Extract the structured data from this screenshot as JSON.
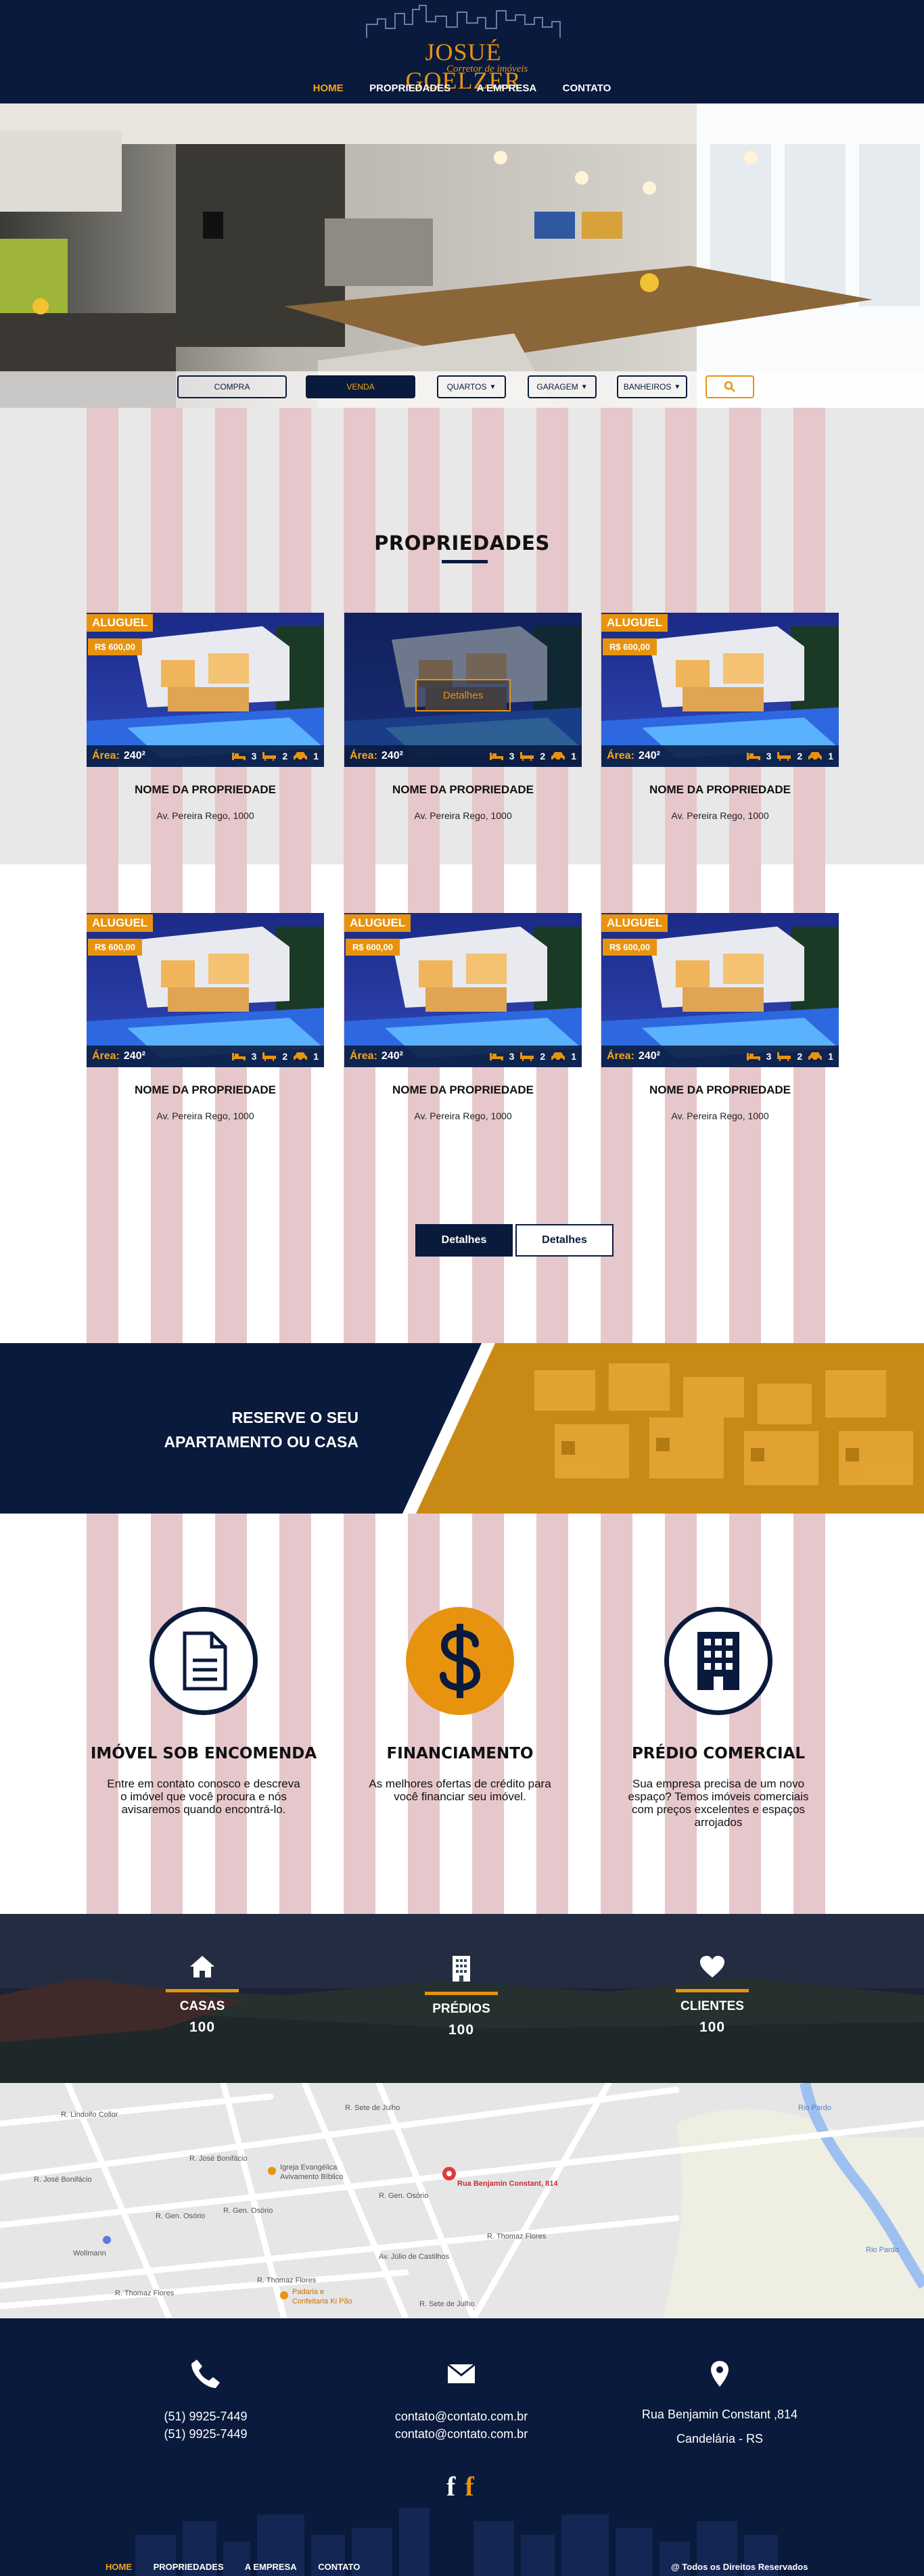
{
  "brand": {
    "name": "JOSUÉ GOELZER",
    "subtitle": "Corretor de imóveis"
  },
  "nav": {
    "items": [
      "HOME",
      "PROPRIEDADES",
      "A EMPRESA",
      "CONTATO"
    ],
    "active": "HOME"
  },
  "search": {
    "compra": "COMPRA",
    "venda": "VENDA",
    "quartos": "QUARTOS",
    "garagem": "GARAGEM",
    "banheiros": "BANHEIROS"
  },
  "properties": {
    "title": "PROPRIEDADES",
    "cards": [
      {
        "tag": "ALUGUEL",
        "price": "R$ 600,00",
        "area_label": "Área:",
        "area": "240²",
        "beds": "3",
        "baths": "2",
        "cars": "1",
        "name": "NOME DA PROPRIEDADE",
        "address": "Av. Pereira Rego, 1000"
      },
      {
        "tag": "",
        "price": "",
        "area_label": "Área:",
        "area": "240²",
        "beds": "3",
        "baths": "2",
        "cars": "1",
        "name": "NOME DA PROPRIEDADE",
        "address": "Av. Pereira Rego, 1000",
        "details": "Detalhes"
      },
      {
        "tag": "ALUGUEL",
        "price": "R$ 600,00",
        "area_label": "Área:",
        "area": "240²",
        "beds": "3",
        "baths": "2",
        "cars": "1",
        "name": "NOME DA PROPRIEDADE",
        "address": "Av. Pereira Rego, 1000"
      },
      {
        "tag": "ALUGUEL",
        "price": "R$ 600,00",
        "area_label": "Área:",
        "area": "240²",
        "beds": "3",
        "baths": "2",
        "cars": "1",
        "name": "NOME DA PROPRIEDADE",
        "address": "Av. Pereira Rego, 1000"
      },
      {
        "tag": "ALUGUEL",
        "price": "R$ 600,00",
        "area_label": "Área:",
        "area": "240²",
        "beds": "3",
        "baths": "2",
        "cars": "1",
        "name": "NOME DA PROPRIEDADE",
        "address": "Av. Pereira Rego, 1000"
      },
      {
        "tag": "ALUGUEL",
        "price": "R$ 600,00",
        "area_label": "Área:",
        "area": "240²",
        "beds": "3",
        "baths": "2",
        "cars": "1",
        "name": "NOME DA PROPRIEDADE",
        "address": "Av. Pereira Rego, 1000"
      }
    ],
    "pagination": [
      "Detalhes",
      "Detalhes"
    ]
  },
  "cta": {
    "line1": "RESERVE O SEU",
    "line2": "APARTAMENTO OU CASA"
  },
  "features": [
    {
      "icon": "document-icon",
      "title": "IMÓVEL SOB ENCOMENDA",
      "desc": "Entre em contato conosco e descreva o imóvel que você procura e nós avisaremos quando encontrá-lo."
    },
    {
      "icon": "dollar-icon",
      "title": "FINANCIAMENTO",
      "desc": "As melhores ofertas de crédito para você financiar seu imóvel."
    },
    {
      "icon": "building-icon",
      "title": "PRÉDIO COMERCIAL",
      "desc": "Sua empresa precisa de um novo espaço? Temos imóveis comerciais com preços excelentes e espaços arrojados"
    }
  ],
  "stats": [
    {
      "icon": "home-icon",
      "label": "CASAS",
      "value": "100"
    },
    {
      "icon": "building-icon",
      "label": "PRÉDIOS",
      "value": "100"
    },
    {
      "icon": "heart-icon",
      "label": "CLIENTES",
      "value": "100"
    }
  ],
  "map": {
    "marker": "Rua Benjamin Constant, 814",
    "streets": [
      "R. José Bonifácio",
      "R. José Bonifácio",
      "R. Gen. Osório",
      "R. Gen. Osório",
      "R. Gen. Osório",
      "R. Thomaz Flores",
      "R. Thomaz Flores",
      "R. Thomaz Flores",
      "Av. Júlio de Castilhos",
      "R. Sete de Julho",
      "R. Sete de Julho",
      "Rio Pardo",
      "Rio Pardo",
      "R. Lindolfo Collor"
    ],
    "places": [
      "Igreja Evangélica Avivamento Bíblico",
      "Wollmann",
      "Padaria e Confeitaria Ki Pão"
    ]
  },
  "footer": {
    "phones": [
      "(51) 9925-7449",
      "(51) 9925-7449"
    ],
    "emails": [
      "contato@contato.com.br",
      "contato@contato.com.br"
    ],
    "address": [
      "Rua Benjamin Constant ,814",
      "Candelária - RS"
    ],
    "social": [
      "f",
      "f"
    ],
    "links": [
      "HOME",
      "PROPRIEDADES",
      "A EMPRESA",
      "CONTATO"
    ],
    "copyright": "@ Todos os Direitos Reservados"
  },
  "colors": {
    "navy": "#0a1a3c",
    "orange": "#e8930f",
    "stripe": "#e6c7cb"
  }
}
